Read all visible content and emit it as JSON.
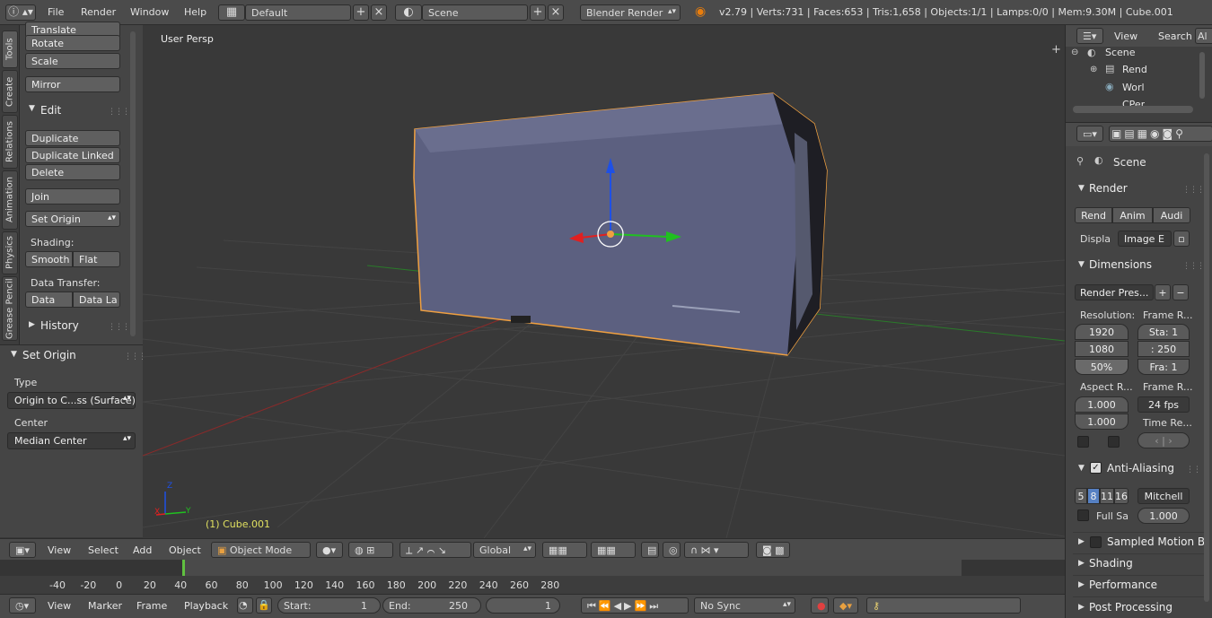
{
  "topbar": {
    "menus": [
      "File",
      "Render",
      "Window",
      "Help"
    ],
    "screen_layout": "Default",
    "scene": "Scene",
    "render_engine": "Blender Render",
    "stats": "v2.79 | Verts:731 | Faces:653 | Tris:1,658 | Objects:1/1 | Lamps:0/0 | Mem:9.30M | Cube.001"
  },
  "tool_tabs": [
    "Tools",
    "Create",
    "Relations",
    "Animation",
    "Physics",
    "Grease Pencil"
  ],
  "shelf": {
    "transform_buttons": [
      "Translate",
      "Rotate",
      "Scale"
    ],
    "mirror": "Mirror",
    "edit_title": "Edit",
    "edit_buttons": [
      "Duplicate",
      "Duplicate Linked",
      "Delete"
    ],
    "join": "Join",
    "set_origin": "Set Origin",
    "shading_label": "Shading:",
    "smooth": "Smooth",
    "flat": "Flat",
    "data_transfer_label": "Data Transfer:",
    "data": "Data",
    "data_layers": "Data La",
    "history": "History"
  },
  "operator_panel": {
    "title": "Set Origin",
    "type_label": "Type",
    "type_value": "Origin to C...ss (Surface)",
    "center_label": "Center",
    "center_value": "Median Center"
  },
  "viewport": {
    "view_name": "User Persp",
    "object_label": "(1) Cube.001",
    "axis_labels": {
      "x": "X",
      "y": "Y",
      "z": "Z"
    }
  },
  "header3d": {
    "menus": [
      "View",
      "Select",
      "Add",
      "Object"
    ],
    "mode": "Object Mode",
    "orientation": "Global"
  },
  "timeline": {
    "ticks": [
      "-40",
      "-20",
      "0",
      "20",
      "40",
      "60",
      "80",
      "100",
      "120",
      "140",
      "160",
      "180",
      "200",
      "220",
      "240",
      "260",
      "280"
    ],
    "current_frame_marker": 0,
    "menus": [
      "View",
      "Marker",
      "Frame",
      "Playback"
    ],
    "start_label": "Start:",
    "start_value": "1",
    "end_label": "End:",
    "end_value": "250",
    "current_frame": "1",
    "sync": "No Sync"
  },
  "outliner": {
    "view": "View",
    "search": "Search",
    "all_tab": "Al",
    "items": [
      "Scene",
      "Rend",
      "Worl",
      "CPer"
    ]
  },
  "properties": {
    "context": "Scene",
    "render_title": "Render",
    "render_buttons": [
      "Rend",
      "Anim",
      "Audi"
    ],
    "display_label": "Displa",
    "display_value": "Image E",
    "dimensions_title": "Dimensions",
    "render_presets": "Render Pres...",
    "resolution_label": "Resolution:",
    "res_x": "1920",
    "res_y": "1080",
    "res_pct": "50%",
    "frame_range_label": "Frame R...",
    "frame_start": "Sta: 1",
    "frame_end": ": 250",
    "frame_step": "Fra: 1",
    "aspect_label": "Aspect R...",
    "aspect_x": "1.000",
    "aspect_y": "1.000",
    "frame_rate_label": "Frame R...",
    "fps": "24 fps",
    "time_remap_label": "Time Re...",
    "aa_title": "Anti-Aliasing",
    "aa_samples": [
      "5",
      "8",
      "11",
      "16"
    ],
    "aa_filter": "Mitchell",
    "full_sample": "Full Sa",
    "filter_size": "1.000",
    "collapsed_panels": [
      "Sampled Motion B",
      "Shading",
      "Performance",
      "Post Processing"
    ]
  },
  "colors": {
    "selection_outline": "#f0a040",
    "x_axis": "#e02020",
    "y_axis": "#20c020",
    "z_axis": "#1e50e6",
    "object_text": "#e0e060",
    "current_frame": "#60c040"
  }
}
